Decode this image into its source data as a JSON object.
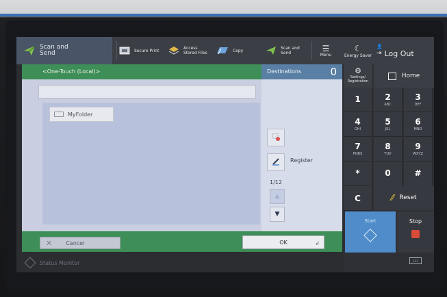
{
  "topbar": {
    "scan_main": {
      "line1": "Scan and",
      "line2": "Send",
      "icon": "paper-plane-icon"
    },
    "secure_print": "Secure Print",
    "access_files": {
      "line1": "Access",
      "line2": "Stored Files"
    },
    "copy": "Copy",
    "scan_send": {
      "line1": "Scan and",
      "line2": "Send"
    },
    "menu": "Menu",
    "energy_saver": "Energy Saver",
    "log_out": "Log Out"
  },
  "header": {
    "location": "<One-Touch (Local)>",
    "destinations_label": "Destinations",
    "destinations_count": "0"
  },
  "main": {
    "folders": [
      {
        "label": "MyFolder"
      }
    ],
    "register_label": "Register",
    "page_indicator": "1/12"
  },
  "actions": {
    "cancel": "Cancel",
    "ok": "OK"
  },
  "status": {
    "monitor": "Status Monitor"
  },
  "keypad": {
    "settings": "Settings/ Registration",
    "home": "Home",
    "keys": [
      {
        "main": "1",
        "sub": ""
      },
      {
        "main": "2",
        "sub": "ABC"
      },
      {
        "main": "3",
        "sub": "DEF"
      },
      {
        "main": "4",
        "sub": "GHI"
      },
      {
        "main": "5",
        "sub": "JKL"
      },
      {
        "main": "6",
        "sub": "MNO"
      },
      {
        "main": "7",
        "sub": "PQRS"
      },
      {
        "main": "8",
        "sub": "TUV"
      },
      {
        "main": "9",
        "sub": "WXYZ"
      },
      {
        "main": "*",
        "sub": ""
      },
      {
        "main": "0",
        "sub": ""
      },
      {
        "main": "#",
        "sub": ""
      }
    ],
    "clear": "C",
    "reset": "Reset",
    "start": "Start",
    "stop": "Stop",
    "counter": "123"
  },
  "colors": {
    "green": "#3e8e57",
    "blue_header": "#5a7fa4",
    "start_blue": "#4f8cc9",
    "stop_red": "#d94c3a"
  }
}
